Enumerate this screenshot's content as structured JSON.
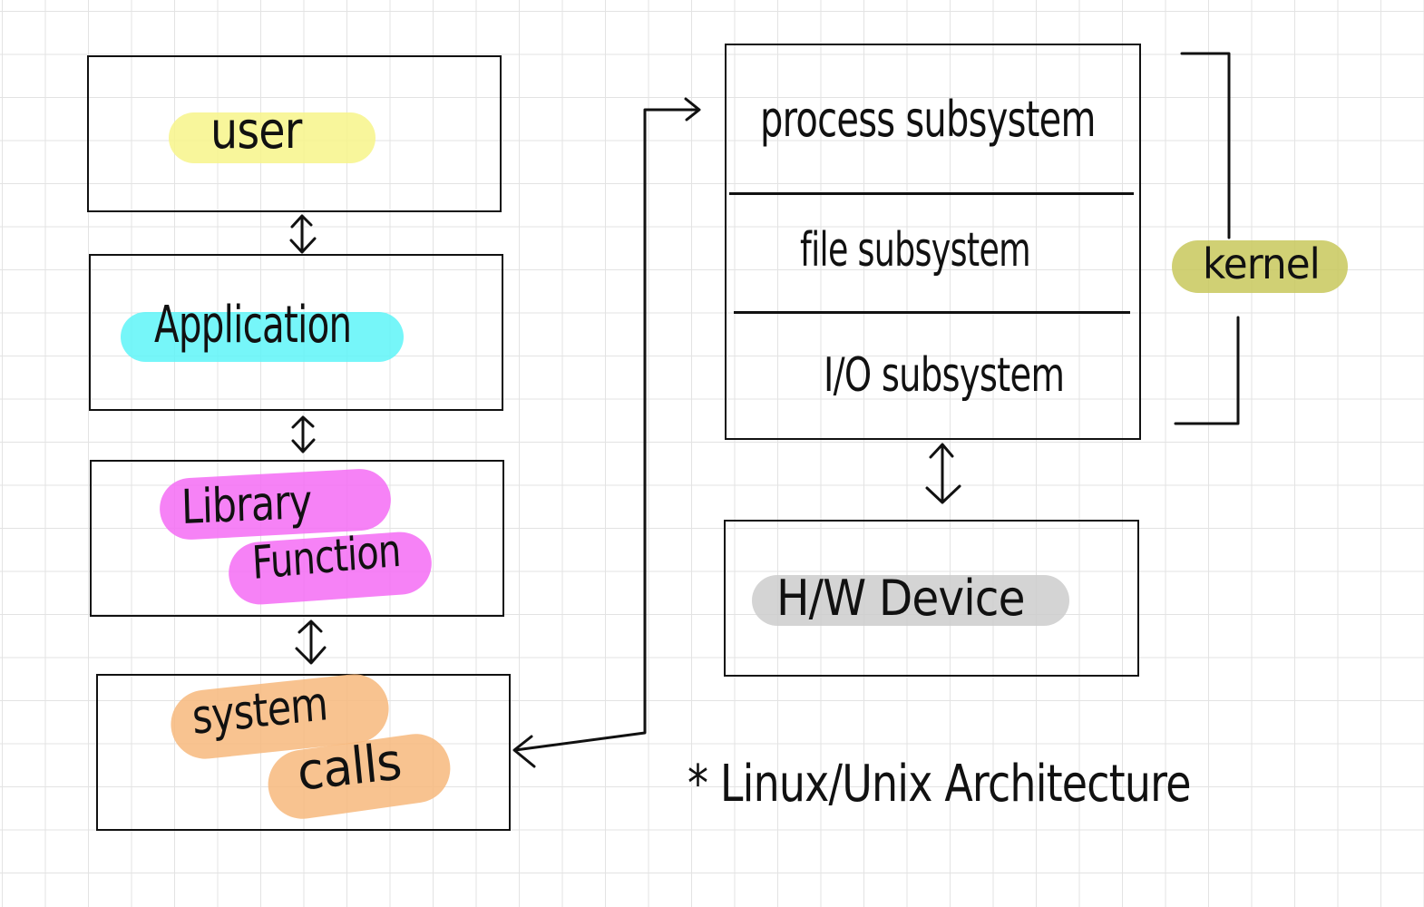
{
  "colors": {
    "user": "#f7f58a",
    "application": "#5ef5f8",
    "library": "#f56cf5",
    "syscalls": "#f7b97c",
    "kernel": "#c8c85c",
    "device": "#cccccc",
    "ink": "#111111"
  },
  "left_stack": {
    "user": "user",
    "application": "Application",
    "library_line1": "Library",
    "library_line2": "Function",
    "syscalls_line1": "system",
    "syscalls_line2": "calls"
  },
  "kernel_box": {
    "process": "process subsystem",
    "file": "file subsystem",
    "io": "I/O subsystem"
  },
  "kernel_label": "kernel",
  "device_box": {
    "label": "H/W Device"
  },
  "caption": "* Linux/Unix Architecture"
}
